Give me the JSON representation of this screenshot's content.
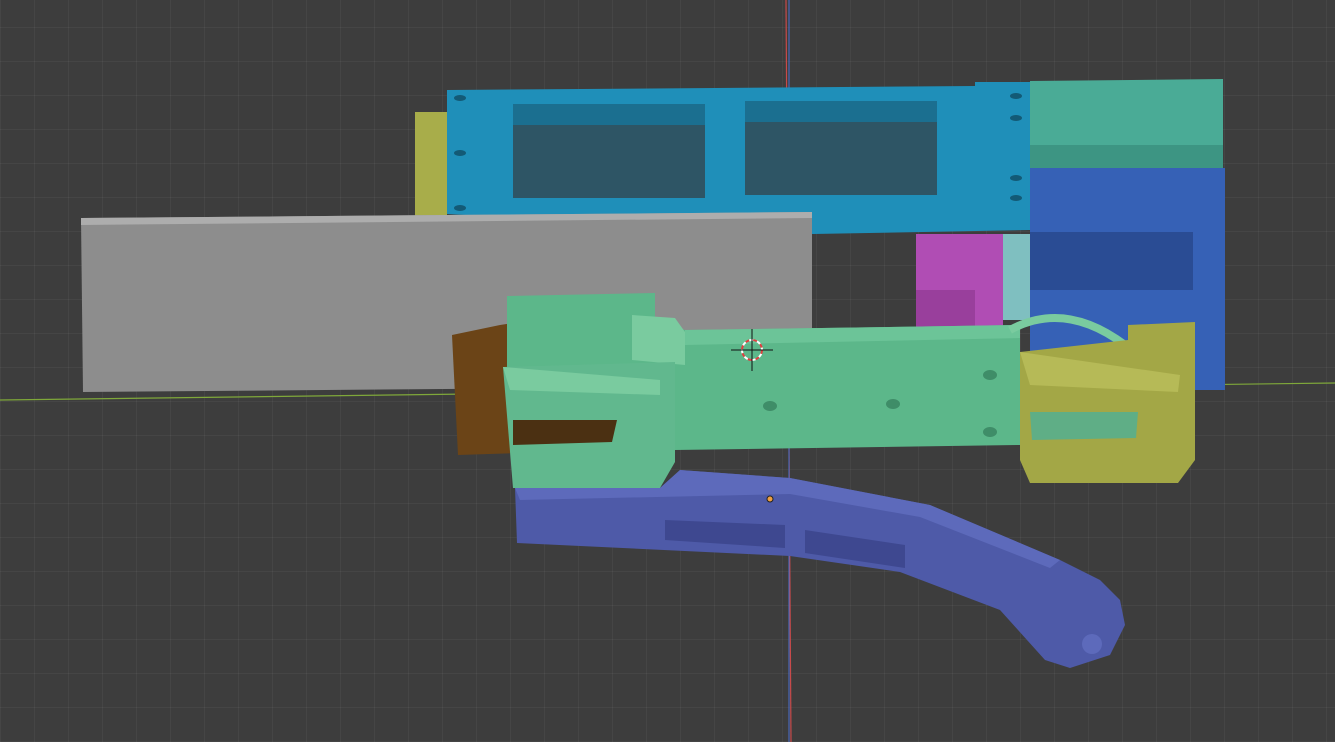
{
  "viewport": {
    "mode": "3d-viewport",
    "icons": [
      "3d-cursor-icon",
      "object-origin-icon"
    ]
  },
  "colors": {
    "background": "#3d3d3d",
    "x_axis": "#7fa83a",
    "y_axis": "#c84a4a",
    "z_axis": "#4a6fd0",
    "blue_frame": "#1f8fb9",
    "teal_block": "#4aab96",
    "royal_block": "#3661b6",
    "magenta_block": "#b04db4",
    "grey_plate": "#8d8d8d",
    "olive_plate": "#a8ad4a",
    "brown_part": "#6b4417",
    "green_arm": "#5cb78a",
    "yellow_box": "#a3a746",
    "purple_arm": "#4e5aa8",
    "origin_dot": "#f0a040"
  }
}
